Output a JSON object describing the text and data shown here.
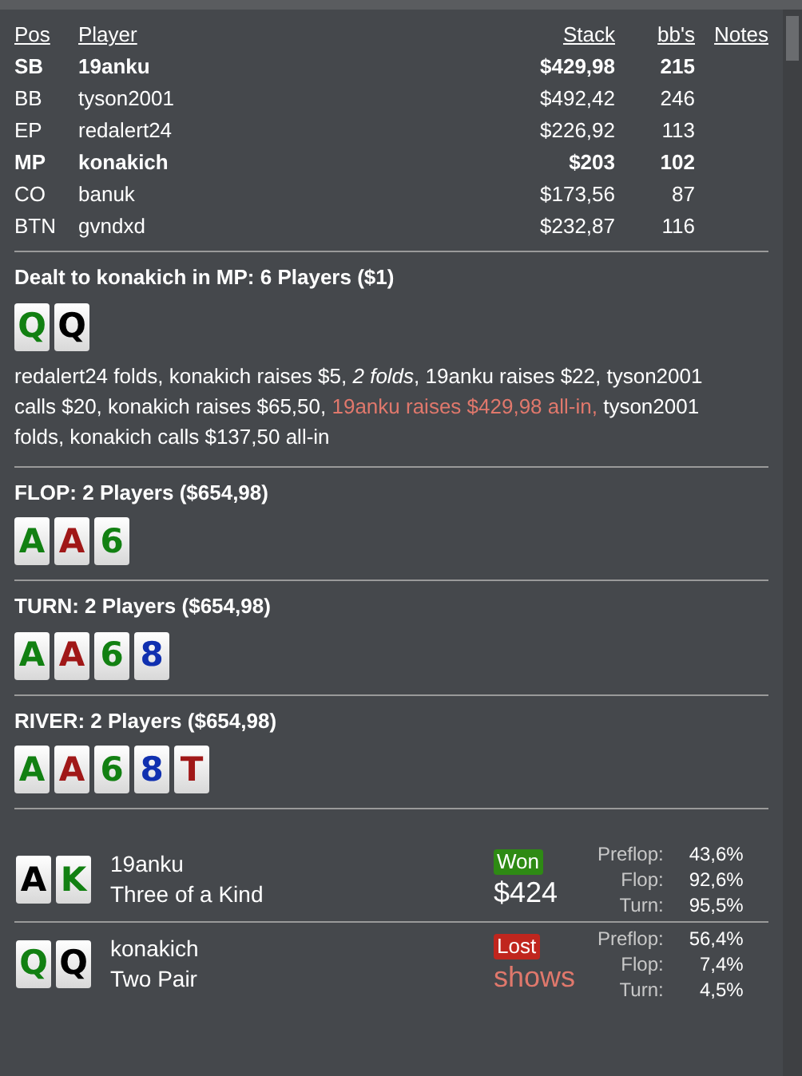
{
  "table": {
    "columns": [
      "Pos",
      "Player",
      "Stack",
      "bb's",
      "Notes"
    ],
    "rows": [
      {
        "pos": "SB",
        "player": "19anku",
        "stack": "$429,98",
        "bbs": "215",
        "highlighted": true
      },
      {
        "pos": "BB",
        "player": "tyson2001",
        "stack": "$492,42",
        "bbs": "246",
        "highlighted": false
      },
      {
        "pos": "EP",
        "player": "redalert24",
        "stack": "$226,92",
        "bbs": "113",
        "highlighted": false
      },
      {
        "pos": "MP",
        "player": "konakich",
        "stack": "$203",
        "bbs": "102",
        "highlighted": true
      },
      {
        "pos": "CO",
        "player": "banuk",
        "stack": "$173,56",
        "bbs": "87",
        "highlighted": false
      },
      {
        "pos": "BTN",
        "player": "gvndxd",
        "stack": "$232,87",
        "bbs": "116",
        "highlighted": false
      }
    ]
  },
  "streets": [
    {
      "title": "Dealt to konakich in MP: 6 Players ($1)",
      "cards": [
        {
          "rank": "Q",
          "color": "#128012"
        },
        {
          "rank": "Q",
          "color": "#000000"
        }
      ],
      "actions": [
        {
          "kind": "normal",
          "text": "redalert24 folds, konakich raises $5, "
        },
        {
          "kind": "italic",
          "text": "2 folds"
        },
        {
          "kind": "normal",
          "text": ", 19anku raises $22, tyson2001 calls $20, konakich raises $65,50, "
        },
        {
          "kind": "allin",
          "text": "19anku raises $429,98 all-in,"
        },
        {
          "kind": "normal",
          "text": " tyson2001 folds, konakich calls $137,50 all-in"
        }
      ]
    },
    {
      "title": "FLOP: 2 Players ($654,98)",
      "cards": [
        {
          "rank": "A",
          "color": "#128012"
        },
        {
          "rank": "A",
          "color": "#a01818"
        },
        {
          "rank": "6",
          "color": "#128012"
        }
      ]
    },
    {
      "title": "TURN: 2 Players ($654,98)",
      "cards": [
        {
          "rank": "A",
          "color": "#128012"
        },
        {
          "rank": "A",
          "color": "#a01818"
        },
        {
          "rank": "6",
          "color": "#128012"
        },
        {
          "rank": "8",
          "color": "#1030b0"
        }
      ]
    },
    {
      "title": "RIVER: 2 Players ($654,98)",
      "cards": [
        {
          "rank": "A",
          "color": "#128012"
        },
        {
          "rank": "A",
          "color": "#a01818"
        },
        {
          "rank": "6",
          "color": "#128012"
        },
        {
          "rank": "8",
          "color": "#1030b0"
        },
        {
          "rank": "T",
          "color": "#a01818"
        }
      ]
    }
  ],
  "showdown": [
    {
      "cards": [
        {
          "rank": "A",
          "color": "#000000"
        },
        {
          "rank": "K",
          "color": "#128012"
        }
      ],
      "player": "19anku",
      "hand": "Three of a Kind",
      "result": {
        "kind": "won",
        "label": "Won"
      },
      "amount": "$424",
      "equity": [
        {
          "street": "Preflop:",
          "value": "43,6%"
        },
        {
          "street": "Flop:",
          "value": "92,6%"
        },
        {
          "street": "Turn:",
          "value": "95,5%"
        }
      ]
    },
    {
      "cards": [
        {
          "rank": "Q",
          "color": "#128012"
        },
        {
          "rank": "Q",
          "color": "#000000"
        }
      ],
      "player": "konakich",
      "hand": "Two Pair",
      "result": {
        "kind": "lost",
        "label": "Lost"
      },
      "amount": "shows",
      "equity": [
        {
          "street": "Preflop:",
          "value": "56,4%"
        },
        {
          "street": "Flop:",
          "value": "7,4%"
        },
        {
          "street": "Turn:",
          "value": "4,5%"
        }
      ]
    }
  ]
}
